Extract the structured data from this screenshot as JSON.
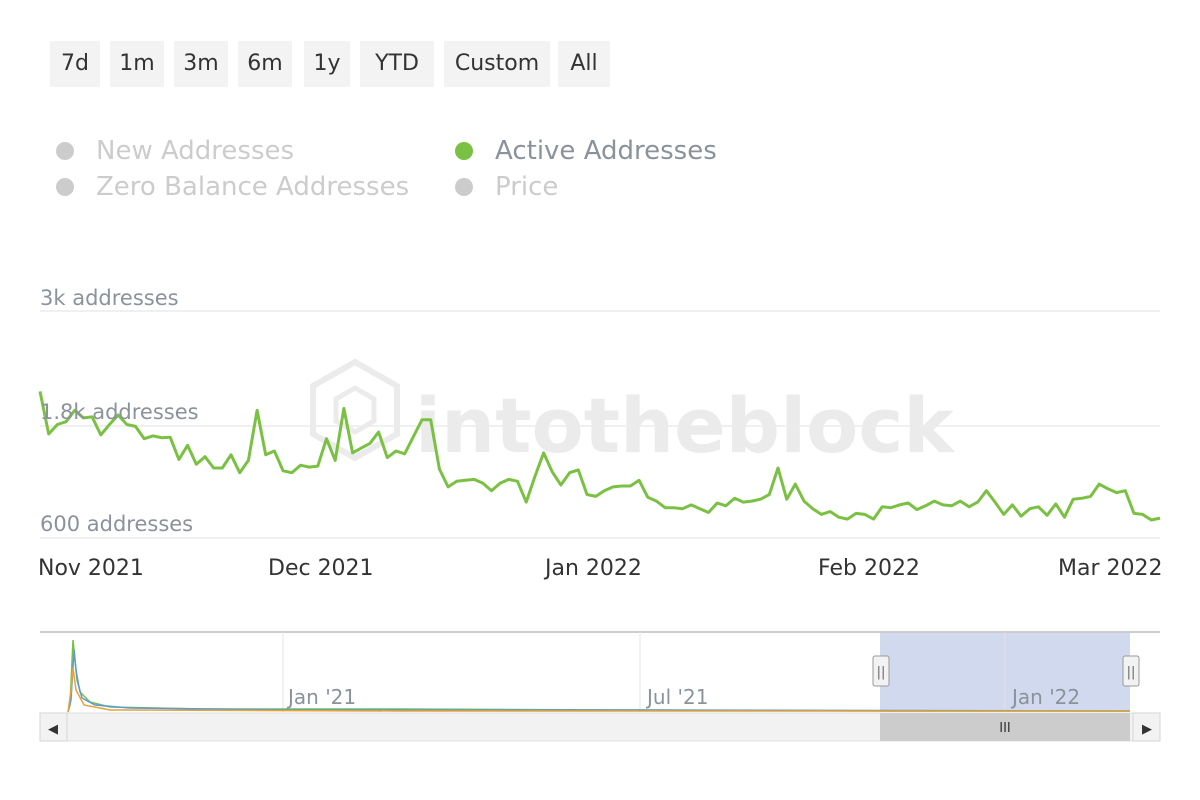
{
  "range_buttons": [
    "7d",
    "1m",
    "3m",
    "6m",
    "1y",
    "YTD",
    "Custom",
    "All"
  ],
  "legend": [
    {
      "label": "New Addresses",
      "active": false,
      "color": "#cccccc"
    },
    {
      "label": "Active Addresses",
      "active": true,
      "color": "#7ac143"
    },
    {
      "label": "Zero Balance Addresses",
      "active": false,
      "color": "#cccccc"
    },
    {
      "label": "Price",
      "active": false,
      "color": "#cccccc"
    }
  ],
  "colors": {
    "active_series": "#7ac143",
    "inactive_text": "#cccccc",
    "active_text": "#8a929b",
    "axis_text": "#8a929b",
    "x_axis_text": "#333333",
    "grid": "#ececec",
    "navigator_mask": "#c8d2ea",
    "scrollbar_thumb": "#cccccc"
  },
  "watermark": "intotheblock",
  "chart_data": {
    "type": "line",
    "series": [
      {
        "name": "Active Addresses",
        "x_range": [
          "2021-11-01",
          "2022-03-06"
        ],
        "values": [
          2150,
          1700,
          1800,
          1830,
          1950,
          1870,
          1880,
          1690,
          1800,
          1900,
          1800,
          1780,
          1650,
          1680,
          1660,
          1665,
          1430,
          1580,
          1380,
          1460,
          1340,
          1340,
          1480,
          1290,
          1420,
          1950,
          1480,
          1520,
          1310,
          1290,
          1370,
          1350,
          1360,
          1650,
          1420,
          1970,
          1500,
          1550,
          1600,
          1720,
          1450,
          1520,
          1490,
          1670,
          1850,
          1850,
          1330,
          1140,
          1200,
          1210,
          1220,
          1180,
          1100,
          1180,
          1220,
          1200,
          980,
          1250,
          1500,
          1300,
          1160,
          1290,
          1320,
          1060,
          1040,
          1100,
          1140,
          1150,
          1150,
          1210,
          1030,
          990,
          920,
          920,
          910,
          950,
          910,
          870,
          970,
          940,
          1020,
          980,
          990,
          1010,
          1060,
          1340,
          1010,
          1170,
          990,
          910,
          850,
          880,
          820,
          800,
          860,
          850,
          800,
          930,
          920,
          950,
          970,
          900,
          940,
          990,
          950,
          940,
          990,
          930,
          980,
          1100,
          980,
          850,
          950,
          830,
          910,
          930,
          840,
          960,
          820,
          1010,
          1020,
          1040,
          1170,
          1120,
          1080,
          1100,
          860,
          850,
          790,
          810
        ]
      }
    ],
    "y_ticks": [
      {
        "value": 600,
        "label": "600 addresses"
      },
      {
        "value": 1800,
        "label": "1.8k addresses"
      },
      {
        "value": 3000,
        "label": "3k addresses"
      }
    ],
    "ylim": [
      600,
      3000
    ],
    "x_ticks": [
      {
        "date": "2021-11-01",
        "label": "Nov 2021"
      },
      {
        "date": "2021-12-01",
        "label": "Dec 2021"
      },
      {
        "date": "2022-01-01",
        "label": "Jan 2022"
      },
      {
        "date": "2022-02-01",
        "label": "Feb 2022"
      },
      {
        "date": "2022-03-01",
        "label": "Mar 2022"
      }
    ],
    "grid": true,
    "legend_position": "top"
  },
  "navigator": {
    "labels": [
      "Jan '21",
      "Jul '21",
      "Jan '22"
    ],
    "selection": [
      "2021-11-01",
      "2022-03-06"
    ],
    "handle_glyph": "||",
    "scroll_left_glyph": "◀",
    "scroll_right_glyph": "▶",
    "thumb_glyph": "III"
  }
}
